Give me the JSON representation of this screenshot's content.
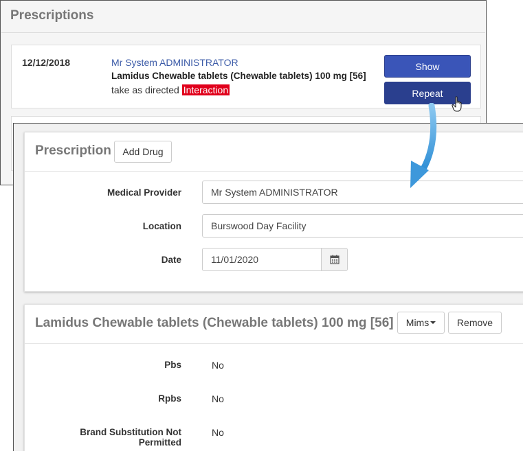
{
  "prescriptions_list": {
    "title": "Prescriptions",
    "items": [
      {
        "date": "12/12/2018",
        "provider": "Mr System ADMINISTRATOR",
        "drug": "Lamidus Chewable tablets (Chewable tablets) 100 mg [56]",
        "instructions": "take as directed",
        "interaction_label": "Interaction",
        "show_label": "Show",
        "repeat_label": "Repeat"
      }
    ]
  },
  "prescription_form": {
    "title": "Prescription",
    "add_drug_label": "Add Drug",
    "fields": {
      "medical_provider": {
        "label": "Medical Provider",
        "value": "Mr System ADMINISTRATOR"
      },
      "location": {
        "label": "Location",
        "value": "Burswood Day Facility"
      },
      "date": {
        "label": "Date",
        "value": "11/01/2020"
      }
    }
  },
  "drug_panel": {
    "title": "Lamidus Chewable tablets (Chewable tablets) 100 mg [56]",
    "mims_label": "Mims",
    "remove_label": "Remove",
    "details": [
      {
        "label": "Pbs",
        "value": "No"
      },
      {
        "label": "Rpbs",
        "value": "No"
      },
      {
        "label": "Brand Substitution Not Permitted",
        "value": "No"
      }
    ]
  },
  "colors": {
    "primary_button": "#3a55b8",
    "repeat_button": "#2a3f8e",
    "interaction_badge": "#e0001b",
    "provider_link": "#3d5ca8",
    "arrow": "#4aa3df"
  },
  "icons": {
    "calendar": "calendar-icon",
    "cursor": "hand-pointer-icon"
  }
}
